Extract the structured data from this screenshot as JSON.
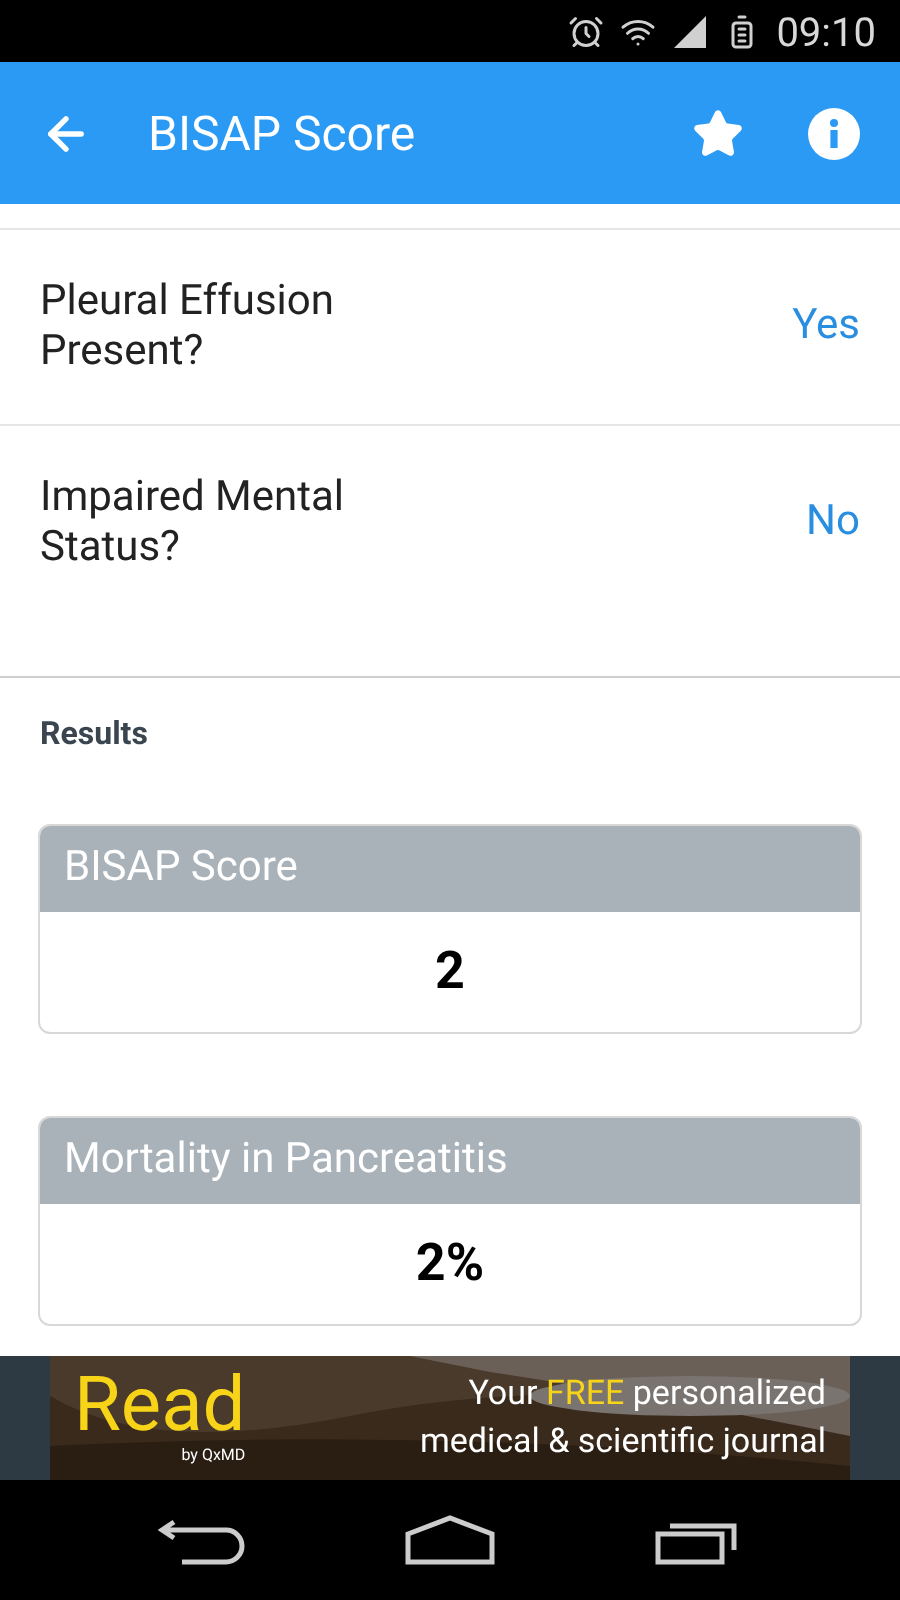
{
  "status_bar": {
    "time": "09:10"
  },
  "app_bar": {
    "title": "BISAP Score",
    "favorite": true
  },
  "questions": [
    {
      "label": "Pleural Effusion Present?",
      "answer": "Yes"
    },
    {
      "label": "Impaired Mental Status?",
      "answer": "No"
    }
  ],
  "results": {
    "heading": "Results",
    "cards": [
      {
        "title": "BISAP Score",
        "value": "2"
      },
      {
        "title": "Mortality in Pancreatitis",
        "value": "2%"
      }
    ]
  },
  "ad": {
    "brand": "Read",
    "byline": "by QxMD",
    "tagline": [
      {
        "text": "Your ",
        "highlight": false
      },
      {
        "text": "FREE",
        "highlight": true
      },
      {
        "text": " personalized medical & scientific journal",
        "highlight": false
      }
    ]
  }
}
